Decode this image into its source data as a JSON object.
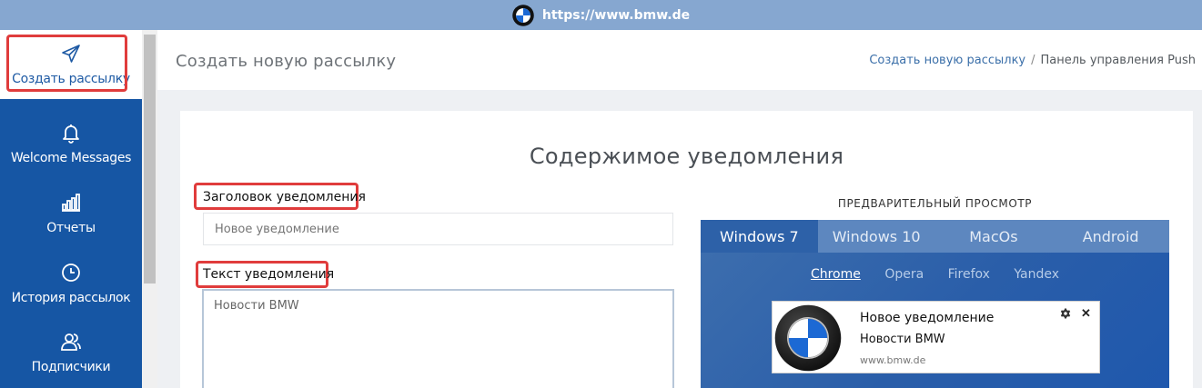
{
  "browser": {
    "url": "https://www.bmw.de"
  },
  "sidebar": {
    "items": [
      {
        "label": "Создать рассылку",
        "icon": "paper-plane-icon"
      },
      {
        "label": "Welcome Messages",
        "icon": "bell-icon"
      },
      {
        "label": "Отчеты",
        "icon": "bar-chart-icon"
      },
      {
        "label": "История рассылок",
        "icon": "clock-icon"
      },
      {
        "label": "Подписчики",
        "icon": "users-icon"
      }
    ]
  },
  "header": {
    "title": "Создать новую рассылку",
    "breadcrumb": {
      "link": "Создать новую рассылку",
      "separator": "/",
      "current": "Панель управления Push"
    }
  },
  "content": {
    "section_title": "Содержимое уведомления",
    "title_field": {
      "label": "Заголовок уведомления",
      "placeholder": "Новое уведомление"
    },
    "text_field": {
      "label": "Текст уведомления",
      "value": "Новости BMW"
    }
  },
  "preview": {
    "label": "ПРЕДВАРИТЕЛЬНЫЙ ПРОСМОТР",
    "os_tabs": [
      "Windows 7",
      "Windows 10",
      "MacOs",
      "Android"
    ],
    "browser_tabs": [
      "Chrome",
      "Opera",
      "Firefox",
      "Yandex"
    ],
    "notification": {
      "title": "Новое уведомление",
      "text": "Новости BMW",
      "site": "www.bmw.de"
    }
  },
  "colors": {
    "sidebar": "#1656a4",
    "highlight": "#e03c3c",
    "topbar": "#86a7d0",
    "preview_bg": "#2a5ea9"
  }
}
